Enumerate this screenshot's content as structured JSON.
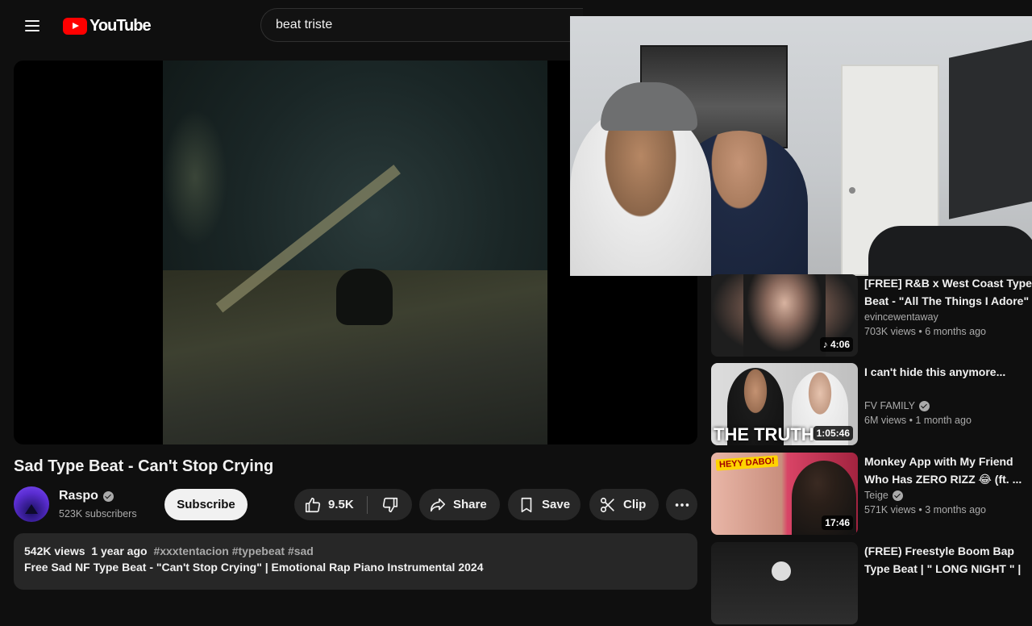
{
  "header": {
    "logo_text": "YouTube",
    "search_value": "beat triste"
  },
  "video": {
    "title": "Sad Type Beat - Can't Stop Crying",
    "channel": "Raspo",
    "subscribers": "523K subscribers",
    "subscribe_label": "Subscribe",
    "likes": "9.5K",
    "share_label": "Share",
    "save_label": "Save",
    "clip_label": "Clip"
  },
  "description": {
    "views": "542K views",
    "age": "1 year ago",
    "tags": "#xxxtentacion #typebeat #sad",
    "line": "Free Sad NF Type Beat - \"Can't Stop Crying\" | Emotional Rap Piano Instrumental 2024"
  },
  "recommendations": [
    {
      "title": "[FREE] R&B x West Coast Type Beat - \"All The Things I Adore\"",
      "channel": "evincewentaway",
      "verified": false,
      "meta": "703K views • 6 months ago",
      "duration": "♪ 4:06"
    },
    {
      "title": "I can't hide this anymore...",
      "channel": "FV FAMILY",
      "verified": true,
      "meta": "6M views • 1 month ago",
      "duration": "1:05:46",
      "thumb_text": "THE TRUTH"
    },
    {
      "title": "Monkey App with My Friend Who Has ZERO RIZZ 😂 (ft. ...",
      "channel": "Teige",
      "verified": true,
      "meta": "571K views • 3 months ago",
      "duration": "17:46",
      "thumb_text": "HEYY DABO!"
    },
    {
      "title": "(FREE) Freestyle Boom Bap Type Beat | \" LONG NIGHT \" | ...",
      "channel": "",
      "verified": false,
      "meta": "",
      "duration": ""
    }
  ],
  "icons": {
    "menu": "menu-icon",
    "like": "thumbs-up-icon",
    "dislike": "thumbs-down-icon",
    "share": "share-arrow-icon",
    "save": "bookmark-icon",
    "clip": "scissors-icon",
    "more": "more-horizontal-icon",
    "verified": "verified-check-icon"
  },
  "colors": {
    "background": "#0f0f0f",
    "brand": "#ff0000",
    "pill": "#272727"
  }
}
